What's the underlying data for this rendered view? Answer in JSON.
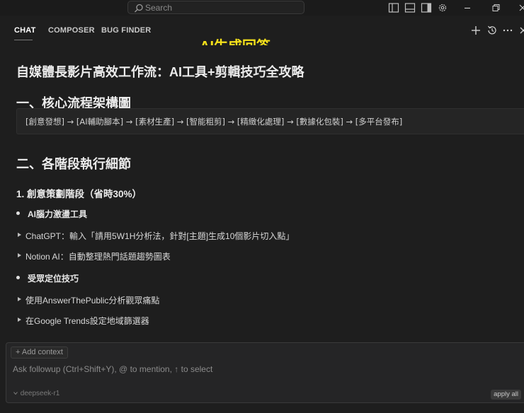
{
  "titlebar": {
    "search_placeholder": "Search"
  },
  "panel": {
    "tabs": [
      {
        "label": "CHAT",
        "active": true
      },
      {
        "label": "COMPOSER",
        "active": false
      },
      {
        "label": "BUG FINDER",
        "active": false
      }
    ],
    "overlay_title": "AI生成回答",
    "overlay_color": "#f5e11b"
  },
  "content": {
    "title": "自媒體長影片高效工作流：AI工具+剪輯技巧全攻略",
    "section1": {
      "heading": "一、核心流程架構圖",
      "flow": "[創意發想] → [AI輔助腳本] → [素材生產] → [智能粗剪] → [精緻化處理] → [數據化包裝] → [多平台發布]"
    },
    "section2": {
      "heading": "二、各階段執行細節",
      "subheading": "1. 創意策劃階段（省時30%）",
      "groups": [
        {
          "title": "AI腦力激盪工具",
          "items": [
            "ChatGPT：輸入「請用5W1H分析法，針對[主題]生成10個影片切入點」",
            "Notion AI：自動整理熱門話題趨勢圖表"
          ]
        },
        {
          "title": "受眾定位技巧",
          "items": [
            "使用AnswerThePublic分析觀眾痛點",
            "在Google Trends設定地域篩選器"
          ]
        }
      ]
    }
  },
  "input": {
    "add_context": "+ Add context",
    "placeholder": "Ask followup (Ctrl+Shift+Y), @ to mention, ↑ to select",
    "model": "deepseek-r1",
    "apply_all": "apply all"
  }
}
